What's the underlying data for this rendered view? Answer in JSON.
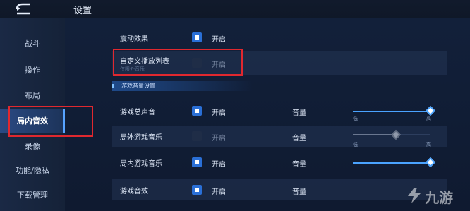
{
  "header": {
    "title": "设置"
  },
  "sidebar": {
    "items": [
      {
        "label": "战斗"
      },
      {
        "label": "操作"
      },
      {
        "label": "布局"
      },
      {
        "label": "局内音效"
      },
      {
        "label": "录像"
      },
      {
        "label": "功能/隐私"
      },
      {
        "label": "下载管理"
      }
    ],
    "active_index": 3
  },
  "settings": {
    "vibration": {
      "label": "震动效果",
      "option": "开启",
      "checked": true
    },
    "playlist": {
      "label": "自定义播放列表",
      "sub": "仅限外音乐",
      "option": "开启",
      "checked": false
    }
  },
  "section": {
    "title": "游戏音量设置"
  },
  "volume_rows": [
    {
      "label": "游戏总声音",
      "option": "开启",
      "checked": true,
      "volume_label": "音量",
      "level": 1.0,
      "low": "低",
      "high": "高"
    },
    {
      "label": "局外游戏音乐",
      "option": "开启",
      "checked": false,
      "volume_label": "音量",
      "level": 0.55,
      "low": "低",
      "high": "高"
    },
    {
      "label": "局内游戏音乐",
      "option": "开启",
      "checked": true,
      "volume_label": "音量",
      "level": 1.0
    },
    {
      "label": "游戏音效",
      "option": "开启",
      "checked": true,
      "volume_label": "音量"
    }
  ],
  "watermark": {
    "text": "九游"
  },
  "colors": {
    "accent": "#2a6fd6",
    "highlight_box": "#e0282f",
    "slider": "#4aa3ff"
  }
}
